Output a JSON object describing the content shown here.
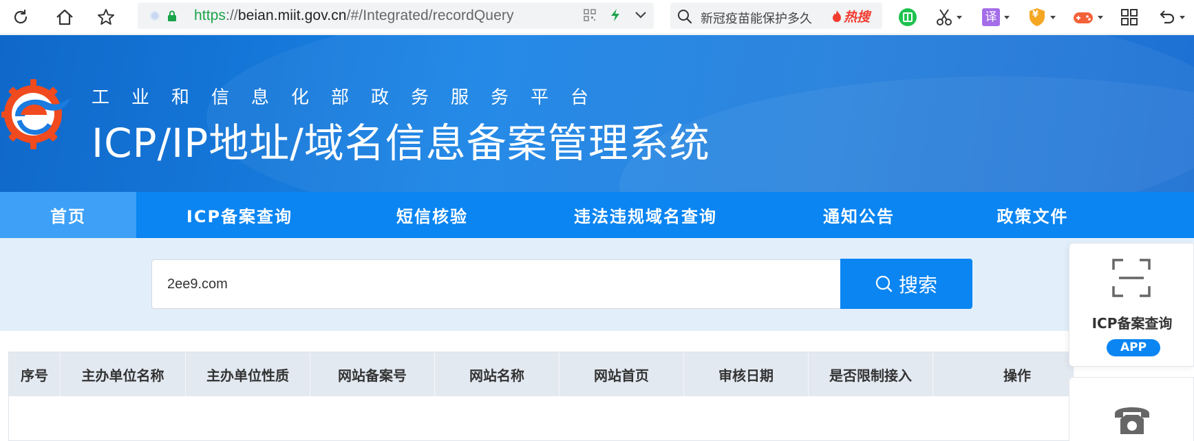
{
  "browser": {
    "url_scheme": "https",
    "url_sep": "://",
    "url_host": "beian.miit.gov.cn",
    "url_path": "/#/Integrated/recordQuery",
    "search_hint": "新冠疫苗能保护多久",
    "search_hot": "热搜",
    "translate_label": "译",
    "wallet_label": "¥"
  },
  "banner": {
    "subtitle": "工业和信息化部政务服务平台",
    "title": "ICP/IP地址/域名信息备案管理系统"
  },
  "nav": {
    "items": [
      {
        "label": "首页"
      },
      {
        "label": "ICP备案查询"
      },
      {
        "label": "短信核验"
      },
      {
        "label": "违法违规域名查询"
      },
      {
        "label": "通知公告"
      },
      {
        "label": "政策文件"
      }
    ]
  },
  "search": {
    "value": "2ee9.com",
    "button_label": "搜索"
  },
  "table": {
    "headers": [
      "序号",
      "主办单位名称",
      "主办单位性质",
      "网站备案号",
      "网站名称",
      "网站首页",
      "审核日期",
      "是否限制接入",
      "操作"
    ]
  },
  "side": {
    "icp_label": "ICP备案查询",
    "app_label": "APP"
  },
  "colors": {
    "brand_blue": "#0a85f2",
    "active_tab": "#3ea0f7",
    "search_area_bg": "#e2effb",
    "secure_green": "#1aa34a"
  },
  "icons": [
    "reload-icon",
    "home-icon",
    "star-icon",
    "lock-icon",
    "qr-icon",
    "lightning-icon",
    "search-icon",
    "fire-icon",
    "scan-icon",
    "phone-icon"
  ]
}
